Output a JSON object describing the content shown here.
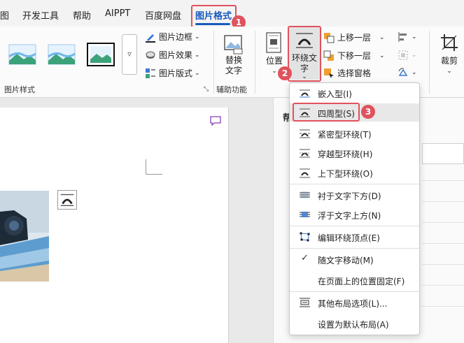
{
  "tabs": [
    {
      "label": "图"
    },
    {
      "label": "开发工具"
    },
    {
      "label": "帮助"
    },
    {
      "label": "AIPPT"
    },
    {
      "label": "百度网盘"
    },
    {
      "label": "图片格式"
    }
  ],
  "callouts": [
    "1",
    "2",
    "3"
  ],
  "ribbon": {
    "picture_styles_group": "图片样式",
    "picture_border": "图片边框",
    "picture_effects": "图片效果",
    "picture_layout": "图片版式",
    "alt_text_line1": "替换",
    "alt_text_line2": "文字",
    "accessibility_group": "辅助功能",
    "position": "位置",
    "wrap_text_line1": "环绕文",
    "wrap_text_line2": "字",
    "bring_forward": "上移一层",
    "send_backward": "下移一层",
    "selection_pane": "选择窗格",
    "crop": "裁剪"
  },
  "pane": {
    "title": "帮"
  },
  "wrap_menu": {
    "items": [
      {
        "label": "嵌入型(I)",
        "icon": "inline-icon"
      },
      {
        "label": "四周型(S)",
        "icon": "square-wrap-icon"
      },
      {
        "label": "紧密型环绕(T)",
        "icon": "tight-wrap-icon"
      },
      {
        "label": "穿越型环绕(H)",
        "icon": "through-wrap-icon"
      },
      {
        "label": "上下型环绕(O)",
        "icon": "top-bottom-wrap-icon"
      },
      {
        "label": "衬于文字下方(D)",
        "icon": "behind-text-icon"
      },
      {
        "label": "浮于文字上方(N)",
        "icon": "in-front-text-icon"
      },
      {
        "label": "编辑环绕顶点(E)",
        "icon": "edit-wrap-points-icon"
      },
      {
        "label": "随文字移动(M)",
        "icon": "check-icon"
      },
      {
        "label": "在页面上的位置固定(F)",
        "icon": ""
      },
      {
        "label": "其他布局选项(L)...",
        "icon": "more-layout-icon"
      },
      {
        "label": "设置为默认布局(A)",
        "icon": ""
      }
    ]
  },
  "colors": {
    "accent": "#185abd",
    "callout": "#e0525c"
  }
}
